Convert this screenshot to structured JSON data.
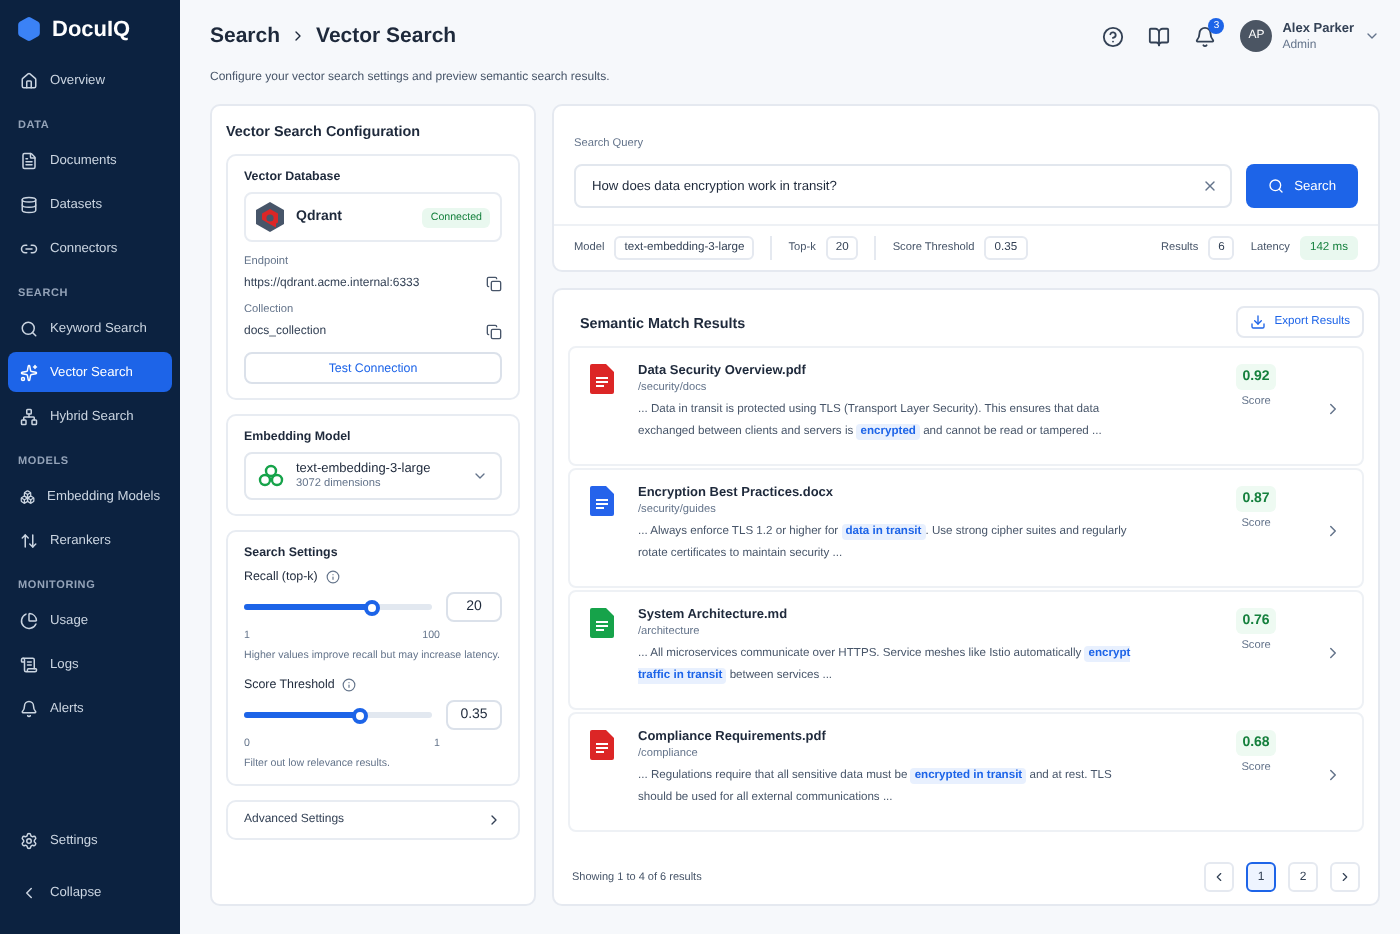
{
  "app": {
    "name": "DocuIQ"
  },
  "sidebar": {
    "sections": [
      {
        "items": [
          {
            "label": "Overview",
            "selected": false
          }
        ]
      },
      {
        "heading": "DATA",
        "items": [
          {
            "label": "Documents",
            "selected": false
          },
          {
            "label": "Datasets",
            "selected": false
          },
          {
            "label": "Connectors",
            "selected": false
          }
        ]
      },
      {
        "heading": "SEARCH",
        "items": [
          {
            "label": "Keyword Search",
            "selected": false
          },
          {
            "label": "Vector Search",
            "selected": true
          },
          {
            "label": "Hybrid Search",
            "selected": false
          }
        ]
      },
      {
        "heading": "MODELS",
        "items": [
          {
            "label": "Embedding Models",
            "selected": false
          },
          {
            "label": "Rerankers",
            "selected": false
          }
        ]
      },
      {
        "heading": "MONITORING",
        "items": [
          {
            "label": "Usage",
            "selected": false
          },
          {
            "label": "Logs",
            "selected": false
          },
          {
            "label": "Alerts",
            "selected": false
          }
        ]
      }
    ],
    "bottom": [
      {
        "label": "Settings"
      },
      {
        "label": "Collapse"
      }
    ]
  },
  "header": {
    "breadcrumb": [
      "Search",
      "Vector Search"
    ],
    "subtitle": "Configure your vector search settings and preview semantic search results.",
    "notifications": "3",
    "user": {
      "initials": "AP",
      "name": "Alex Parker",
      "role": "Admin"
    }
  },
  "config": {
    "title": "Vector Search Configuration",
    "database": {
      "title": "Vector Database",
      "provider": "Qdrant",
      "status": "Connected",
      "endpoint_label": "Endpoint",
      "endpoint": "https://qdrant.acme.internal:6333",
      "collection_label": "Collection",
      "collection": "docs_collection",
      "button": "Test Connection"
    },
    "embedding": {
      "title": "Embedding Model",
      "model": "text-embedding-3-large",
      "dimensions": "3072 dimensions"
    },
    "search_settings": {
      "title": "Search Settings",
      "sliders": [
        {
          "label": "Recall (top-k)",
          "level": 0.68,
          "min": "1",
          "max": "100",
          "value": "20",
          "hint": "Higher values improve recall but may increase latency."
        },
        {
          "label": "Score Threshold",
          "level": 0.62,
          "min": "0",
          "max": "1",
          "value": "0.35",
          "hint": "Filter out low relevance results."
        }
      ]
    },
    "advanced": "Advanced Settings"
  },
  "search": {
    "label": "Search Query",
    "value": "How does data encryption work in transit?",
    "button": "Search",
    "stats": [
      {
        "label": "Model",
        "value": "text-embedding-3-large",
        "kind": "plain"
      },
      {
        "label": "Top-k",
        "value": "20",
        "kind": "plain"
      },
      {
        "label": "Score Threshold",
        "value": "0.35",
        "kind": "plain"
      },
      {
        "label": "Results",
        "value": "6",
        "kind": "plain"
      },
      {
        "label": "Latency",
        "value": "142 ms",
        "kind": "good"
      }
    ]
  },
  "results": {
    "title": "Semantic Match Results",
    "export": "Export Results",
    "rows": [
      {
        "kind": "pdf",
        "name": "Data Security Overview.pdf",
        "path": "/security/docs",
        "score": "0.92",
        "score_label": "Score",
        "snippet": [
          {
            "text": "... Data in transit is protected using TLS (Transport Layer Security). This ensures that data exchanged between clients and servers is ",
            "highlight": false
          },
          {
            "text": "encrypted",
            "highlight": true
          },
          {
            "text": " and cannot be read or tampered ...",
            "highlight": false
          }
        ]
      },
      {
        "kind": "docx",
        "name": "Encryption Best Practices.docx",
        "path": "/security/guides",
        "score": "0.87",
        "score_label": "Score",
        "snippet": [
          {
            "text": "... Always enforce TLS 1.2 or higher for ",
            "highlight": false
          },
          {
            "text": "data in transit",
            "highlight": true
          },
          {
            "text": ". Use strong cipher suites and regularly rotate certificates to maintain security ...",
            "highlight": false
          }
        ]
      },
      {
        "kind": "md",
        "name": "System Architecture.md",
        "path": "/architecture",
        "score": "0.76",
        "score_label": "Score",
        "snippet": [
          {
            "text": "... All microservices communicate over HTTPS. Service meshes like Istio automatically ",
            "highlight": false
          },
          {
            "text": "encrypt traffic in transit",
            "highlight": true
          },
          {
            "text": " between services ...",
            "highlight": false
          }
        ]
      },
      {
        "kind": "pdf",
        "name": "Compliance Requirements.pdf",
        "path": "/compliance",
        "score": "0.68",
        "score_label": "Score",
        "snippet": [
          {
            "text": "... Regulations require that all sensitive data must be ",
            "highlight": false
          },
          {
            "text": "encrypted in transit",
            "highlight": true
          },
          {
            "text": " and at rest. TLS should be used for all external communications ...",
            "highlight": false
          }
        ]
      }
    ],
    "footer": "Showing 1 to 4 of 6 results",
    "pages": [
      {
        "label": "1",
        "selected": true
      },
      {
        "label": "2",
        "selected": false
      }
    ]
  }
}
